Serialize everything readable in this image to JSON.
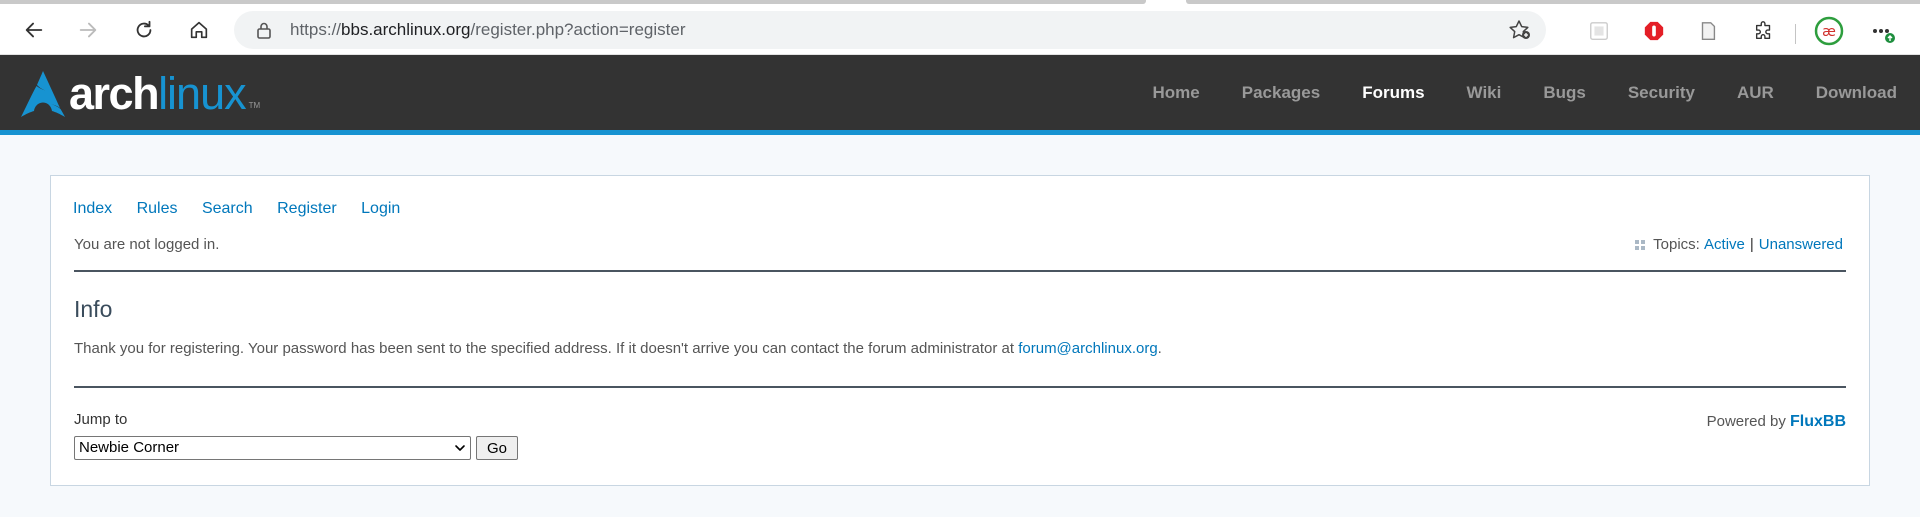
{
  "browser": {
    "url_prefix": "https://",
    "url_host": "bbs.archlinux.org",
    "url_path": "/register.php?action=register"
  },
  "site": {
    "logo_arch": "arch",
    "logo_linux": "linux",
    "logo_tm": "TM",
    "nav": [
      "Home",
      "Packages",
      "Forums",
      "Wiki",
      "Bugs",
      "Security",
      "AUR",
      "Download"
    ],
    "active_nav": "Forums"
  },
  "forum": {
    "links": [
      "Index",
      "Rules",
      "Search",
      "Register",
      "Login"
    ],
    "status": "You are not logged in.",
    "topics_label": "Topics:",
    "topics_active": "Active",
    "topics_sep": "|",
    "topics_unanswered": "Unanswered",
    "info_heading": "Info",
    "info_text": "Thank you for registering. Your password has been sent to the specified address. If it doesn't arrive you can contact the forum administrator at",
    "info_email": "forum@archlinux.org",
    "info_period": ".",
    "jump_label": "Jump to",
    "jump_selected": "Newbie Corner",
    "go_label": "Go",
    "powered_by": "Powered by",
    "powered_link": "FluxBB"
  },
  "colors": {
    "accent": "#1793d1",
    "link": "#0077bb",
    "header_bg": "#333333"
  }
}
